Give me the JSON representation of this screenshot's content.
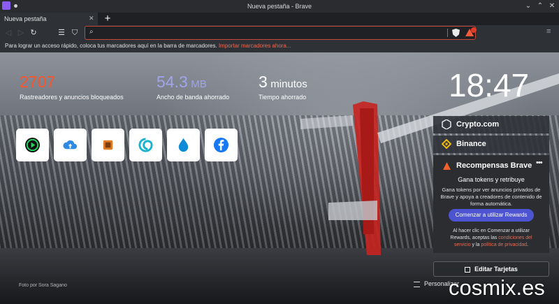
{
  "window": {
    "title": "Nueva pestaña - Brave"
  },
  "tabs": [
    {
      "label": "Nueva pestaña"
    }
  ],
  "new_tab_label": "+",
  "toolbar": {
    "search_icon_glyph": "🔍",
    "url_value": ""
  },
  "bookmarks_bar": {
    "message": "Para lograr un acceso rápido, coloca tus marcadores aquí en la barra de marcadores.",
    "import_link": "Importar marcadores ahora..."
  },
  "stats": [
    {
      "value": "2707",
      "unit": "",
      "label": "Rastreadores y anuncios bloqueados",
      "color": "#fb542b"
    },
    {
      "value": "54.3",
      "unit": "MB",
      "label": "Ancho de banda ahorrado",
      "color": "#a0a5eb"
    },
    {
      "value": "3",
      "unit": "minutos",
      "label": "Tiempo ahorrado",
      "color": "#ffffff"
    }
  ],
  "clock": "18:47",
  "top_sites": [
    {
      "icon": "play-circle-icon",
      "color": "#1ed760"
    },
    {
      "icon": "cloud-upload-icon",
      "color": "#2f8ae5"
    },
    {
      "icon": "orange-square-icon",
      "color": "#e07b20"
    },
    {
      "icon": "spiral-icon",
      "color": "#19b3d0"
    },
    {
      "icon": "water-drop-icon",
      "color": "#0e8bd6"
    },
    {
      "icon": "facebook-icon",
      "color": "#1877f2"
    }
  ],
  "widgets": {
    "crypto": {
      "label": "Crypto.com"
    },
    "binance": {
      "label": "Binance"
    },
    "rewards": {
      "title": "Recompensas Brave",
      "more": "•••",
      "subtitle": "Gana tokens y retribuye",
      "description": "Gana tokens por ver anuncios privados de Brave y apoya a creadores de contenido de forma automática.",
      "cta": "Comenzar a utilizar Rewards",
      "legal_prefix": "Al hacer clic en Comenzar a utilizar Rewards, aceptas las",
      "legal_terms": "condiciones del servicio",
      "legal_and": "y la",
      "legal_privacy": "política de privacidad",
      "legal_end": "."
    },
    "edit_cards": "Editar Tarjetas"
  },
  "photo_credit": "Foto por Sora Sagano",
  "customize": "Personalizar",
  "watermark": "cosmix.es",
  "colors": {
    "accent": "#fb542b",
    "button": "#4c54d2"
  }
}
